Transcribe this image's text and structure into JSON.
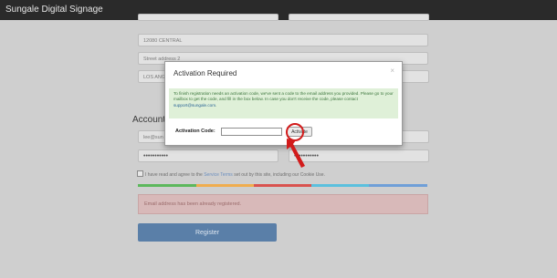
{
  "app": {
    "title": "Sungale Digital Signage"
  },
  "form": {
    "address_line1": "12080 CENTRAL",
    "address_line2_placeholder": "Street address 2",
    "city": "LOS ANG",
    "section_account": "Account",
    "email_partial": "lee@sun",
    "password_mask": "•••••••••••",
    "password_confirm_mask": "•••••••••••",
    "agree": {
      "prefix": "I have read and agree to the ",
      "link": "Service Terms",
      "suffix": " set out by this site, including our Cookie Use."
    },
    "progress_value": 1.0,
    "error": "Email address has been already registered.",
    "register_label": "Register"
  },
  "modal": {
    "title": "Activation Required",
    "close_glyph": "×",
    "info_text_1": "To finish registration needs an activation code, we've sent a code to the email address you provided. Please go to your mailbox to get the code, and fill in the box below. In case you don't receive the code, please contact ",
    "info_email": "support@sungale.com",
    "info_text_2": ".",
    "code_label": "Activation Code:",
    "code_value": "",
    "activate_label": "Activate"
  },
  "colors": {
    "annotation": "#d21b1b",
    "info_bg": "#dff0d8",
    "error_bg": "#d8b9b9",
    "register_bg": "#5a7fa8",
    "progress": [
      "#5cb85c",
      "#f0ad4e",
      "#d9534f",
      "#5bc0de",
      "#6f9fd8"
    ]
  },
  "icons": {
    "close": "close-icon",
    "checkbox": "checkbox-icon",
    "annotation_arrow": "arrow-annotation"
  }
}
